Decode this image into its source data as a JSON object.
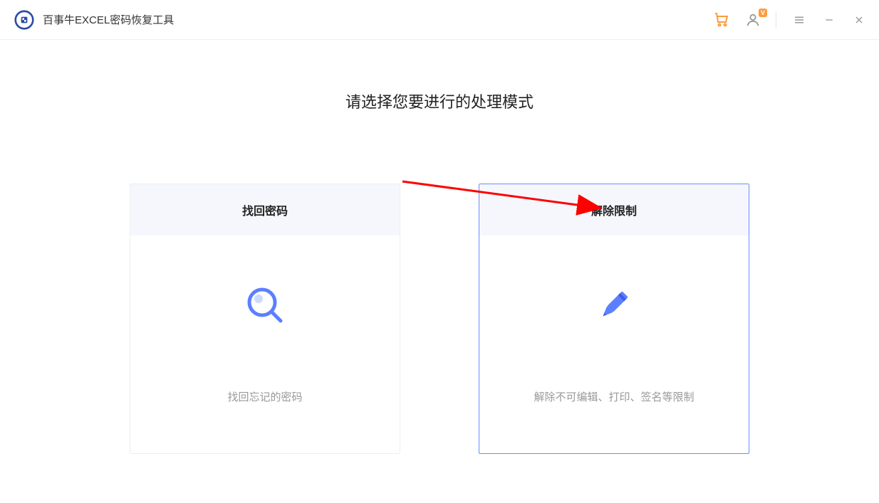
{
  "header": {
    "app_title": "百事牛EXCEL密码恢复工具",
    "vip_badge": "V"
  },
  "main": {
    "heading": "请选择您要进行的处理模式",
    "cards": [
      {
        "title": "找回密码",
        "description": "找回忘记的密码"
      },
      {
        "title": "解除限制",
        "description": "解除不可编辑、打印、签名等限制"
      }
    ]
  }
}
